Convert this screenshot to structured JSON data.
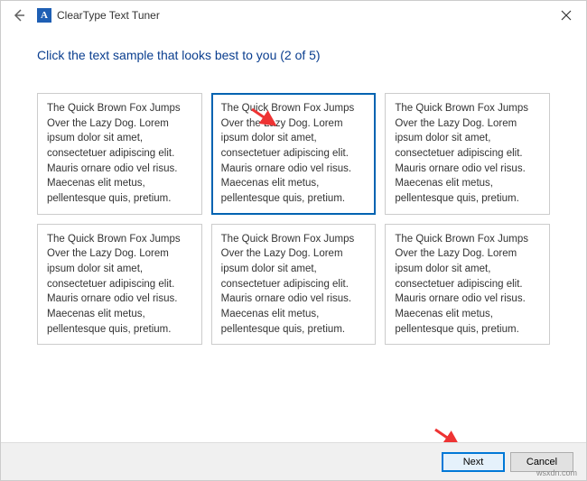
{
  "titlebar": {
    "title": "ClearType Text Tuner"
  },
  "heading": "Click the text sample that looks best to you (2 of 5)",
  "sample_text": "The Quick Brown Fox Jumps Over the Lazy Dog. Lorem ipsum dolor sit amet, consectetuer adipiscing elit. Mauris ornare odio vel risus. Maecenas elit metus, pellentesque quis, pretium.",
  "samples": {
    "selected_index": 1
  },
  "footer": {
    "next_label": "Next",
    "cancel_label": "Cancel"
  },
  "watermark": "wsxdn.com"
}
